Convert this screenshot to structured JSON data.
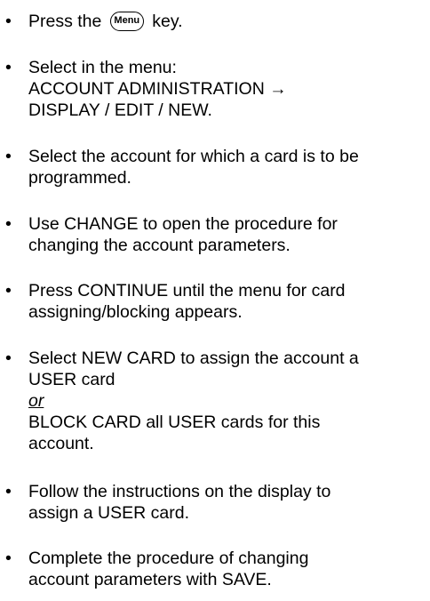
{
  "bullet_char": "•",
  "steps": [
    {
      "before_key": "Press the",
      "key_label": "Menu",
      "after_key": "key."
    },
    {
      "lines": [
        "Select in the menu:",
        "ACCOUNT ADMINISTRATION →",
        "DISPLAY / EDIT / NEW."
      ]
    },
    {
      "lines": [
        "Select the account for which a card is to be",
        "programmed."
      ]
    },
    {
      "lines": [
        "Use CHANGE to open the procedure for",
        "changing the account parameters."
      ]
    },
    {
      "lines": [
        "Press CONTINUE until the menu for card",
        "assigning/blocking appears."
      ]
    },
    {
      "lines": [
        "Select NEW CARD to assign the account a",
        "USER card"
      ],
      "or_text": "or",
      "lines_after": [
        "BLOCK CARD all USER cards for this",
        "account."
      ]
    },
    {
      "lines": [
        "Follow the instructions on the display to",
        "assign a USER card."
      ]
    },
    {
      "lines": [
        "Complete the procedure of changing",
        "account parameters with SAVE."
      ]
    }
  ]
}
